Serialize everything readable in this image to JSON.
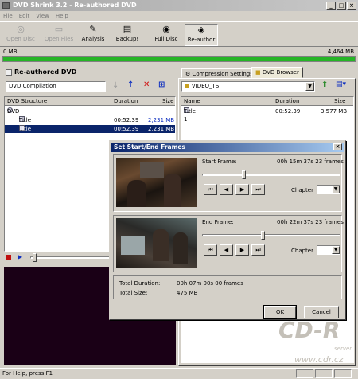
{
  "window": {
    "title": "DVD Shrink 3.2 - Re-authored DVD",
    "min": "_",
    "max": "□",
    "close": "×"
  },
  "menu": [
    "File",
    "Edit",
    "View",
    "Help"
  ],
  "toolbar": {
    "open_disc": "Open Disc",
    "open_files": "Open Files",
    "analysis": "Analysis",
    "backup": "Backup!",
    "full_disc": "Full Disc",
    "re_author": "Re-author"
  },
  "sizebar": {
    "left": "0 MB",
    "right": "4,464 MB",
    "fill_percent": 100,
    "color": "#26b526"
  },
  "left_panel": {
    "title": "Re-authored DVD",
    "compilation": "DVD Compilation",
    "columns": [
      "DVD Structure",
      "Duration",
      "Size"
    ],
    "tree": [
      {
        "name": "DVD",
        "duration": "",
        "size": ""
      },
      {
        "name": "Title 1",
        "duration": "00:52.39",
        "size": "2,231 MB"
      },
      {
        "name": "Title 1 (2)",
        "duration": "00:52.39",
        "size": "2,231 MB"
      }
    ]
  },
  "right_panel": {
    "tabs": [
      "Compression Settings",
      "DVD Browser"
    ],
    "folder": "VIDEO_TS",
    "columns": [
      "Name",
      "Duration",
      "Size"
    ],
    "rows": [
      {
        "name": "Title 1",
        "duration": "00:52.39",
        "size": "3,577 MB"
      }
    ]
  },
  "dialog": {
    "title": "Set Start/End Frames",
    "close": "×",
    "start": {
      "label": "Start Frame:",
      "value": "00h 15m 37s 23 frames",
      "chapter_label": "Chapter",
      "slider_percent": 30
    },
    "end": {
      "label": "End Frame:",
      "value": "00h 22m 37s 23 frames",
      "chapter_label": "Chapter",
      "slider_percent": 44
    },
    "total_duration_label": "Total Duration:",
    "total_duration": "00h 07m 00s 00 frames",
    "total_size_label": "Total Size:",
    "total_size": "475 MB",
    "ok": "OK",
    "cancel": "Cancel",
    "play_buttons": [
      "⏮",
      "◀",
      "▶",
      "⏭"
    ]
  },
  "status": {
    "text": "For Help, press F1"
  },
  "watermark": {
    "logo": "CD-R",
    "sub": "server",
    "url": "www.cdr.cz"
  }
}
